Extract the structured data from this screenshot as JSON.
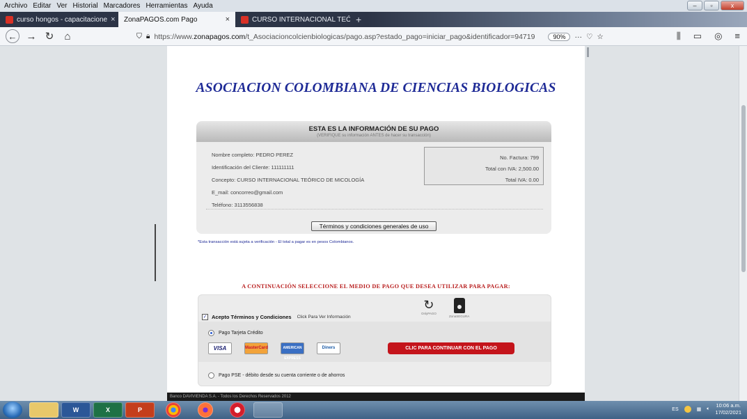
{
  "menu": [
    "Archivo",
    "Editar",
    "Ver",
    "Historial",
    "Marcadores",
    "Herramientas",
    "Ayuda"
  ],
  "tabs": [
    {
      "label": "curso hongos - capacitacione",
      "active": false,
      "favicon_color": "#d93025"
    },
    {
      "label": "ZonaPAGOS.com Pago",
      "active": true,
      "favicon_color": "#f3f5f8"
    },
    {
      "label": "CURSO INTERNACIONAL TEÓ",
      "active": false,
      "favicon_color": "#d93025"
    }
  ],
  "tab_close_glyph": "×",
  "new_tab_glyph": "+",
  "url": {
    "prefix": "https://www.",
    "domain": "zonapagos.com",
    "path": "/t_Asociacioncolcienbiologicas/pago.asp?estado_pago=iniciar_pago&identificador=94719",
    "zoom": "90%"
  },
  "page": {
    "title": "ASOCIACION COLOMBIANA DE CIENCIAS BIOLOGICAS",
    "info_header": "ESTA ES LA INFORMACIÓN DE SU PAGO",
    "info_subheader": "(VERIFIQUE su información ANTES de hacer su transacción)",
    "customer": {
      "name": "Nombre completo: PEDRO PEREZ",
      "id": "Identificación del Cliente: 111111111",
      "concept": "Concepto: CURSO INTERNACIONAL TEÓRICO DE MICOLOGÍA",
      "email": "E_mail: concorreo@gmail.com",
      "phone": "Teléfono: 3113556838"
    },
    "invoice": {
      "number": "No. Factura: 799",
      "total_with_vat": "Total con IVA: 2,500.00",
      "total_vat": "Total IVA: 0.00"
    },
    "terms_button": "Términos y condiciones generales de uso",
    "note": "*Esta transacción está sujeta a verificación - El total a pagar es en pesos Colombianos.",
    "select_title": "A CONTINUACIÓN SELECCIONE EL MEDIO DE PAGO QUE DESEA UTILIZAR PARA PAGAR:",
    "accept_terms": "Acepto Términos y Condiciones",
    "accept_sub": "Click Para Ver Información",
    "secure_icons": [
      "OnlyPAGO",
      "ZonaSEGURA"
    ],
    "credit_card_option": "Pago Tarjeta Crédito",
    "cards": [
      "VISA",
      "MasterCard",
      "AMERICAN EXPRESS",
      "Diners"
    ],
    "continue_button": "CLIC PARA CONTINUAR CON EL PAGO",
    "pse_option": "Pago PSE - débito desde su cuenta corriente o de ahorros",
    "footer": "Banco DAVIVIENDA S.A. - Todos los Derechos Reservados 2012"
  },
  "taskbar": {
    "word": "W",
    "excel": "X",
    "ppt": "P",
    "lang": "ES",
    "time": "10:06 a.m.",
    "date": "17/02/2021"
  }
}
